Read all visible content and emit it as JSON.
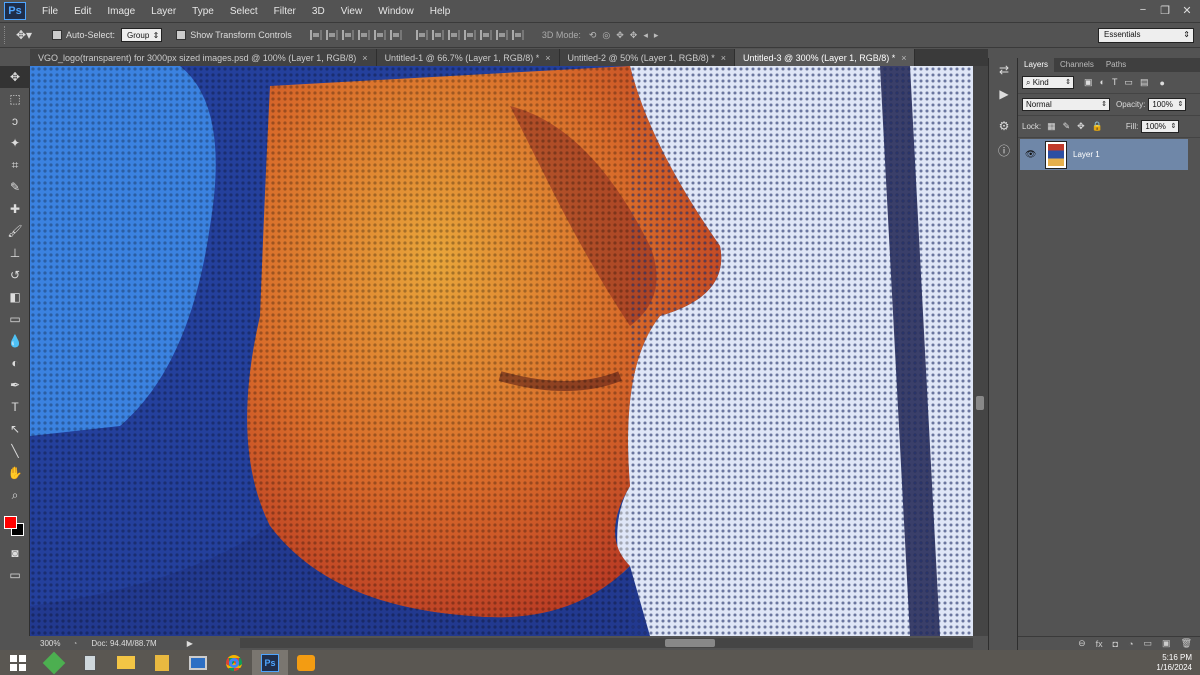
{
  "app": {
    "logo": "Ps"
  },
  "menu": [
    "File",
    "Edit",
    "Image",
    "Layer",
    "Type",
    "Select",
    "Filter",
    "3D",
    "View",
    "Window",
    "Help"
  ],
  "window_buttons": [
    "−",
    "❐",
    "✕"
  ],
  "options": {
    "auto_select_label": "Auto-Select:",
    "auto_select_value": "Group",
    "show_transform_label": "Show Transform Controls",
    "mode_label": "3D Mode:",
    "workspace": "Essentials"
  },
  "doc_tabs": [
    {
      "label": "VGO_logo(transparent) for 3000px sized images.psd @ 100% (Layer 1, RGB/8)",
      "close": "×",
      "active": false
    },
    {
      "label": "Untitled-1 @ 66.7% (Layer 1, RGB/8) *",
      "close": "×",
      "active": false
    },
    {
      "label": "Untitled-2 @ 50% (Layer 1, RGB/8) *",
      "close": "×",
      "active": false
    },
    {
      "label": "Untitled-3 @ 300% (Layer 1, RGB/8) *",
      "close": "×",
      "active": true
    }
  ],
  "tools": [
    "move-icon",
    "marquee-icon",
    "lasso-icon",
    "magic-wand-icon",
    "crop-icon",
    "eyedropper-icon",
    "healing-brush-icon",
    "brush-icon",
    "clone-stamp-icon",
    "history-brush-icon",
    "eraser-icon",
    "gradient-icon",
    "blur-icon",
    "dodge-icon",
    "pen-icon",
    "type-icon",
    "path-selection-icon",
    "line-icon",
    "hand-icon",
    "zoom-icon"
  ],
  "tool_glyphs": [
    "✥",
    "⬚",
    "ↄ",
    "✦",
    "⌗",
    "✎",
    "✚",
    "🖌",
    "⊥",
    "↺",
    "◧",
    "▭",
    "💧",
    "◐",
    "✒",
    "T",
    "↖",
    "╲",
    "✋",
    "⌕"
  ],
  "colors": {
    "foreground": "#ff0000",
    "background": "#000000",
    "selected_layer": "#6f87a8"
  },
  "status": {
    "zoom": "300%",
    "doc": "Doc: 94.4M/88.7M"
  },
  "panel": {
    "tabs": [
      "Layers",
      "Channels",
      "Paths"
    ],
    "kind": "Kind",
    "blend_mode": "Normal",
    "opacity_label": "Opacity:",
    "opacity_value": "100%",
    "lock_label": "Lock:",
    "fill_label": "Fill:",
    "fill_value": "100%",
    "layers": [
      {
        "name": "Layer 1"
      }
    ],
    "footer_icons": [
      "⊖",
      "fx",
      "◘",
      "◔",
      "▭",
      "▣",
      "🗑"
    ]
  },
  "clock": {
    "time": "5:16 PM",
    "date": "1/16/2024"
  }
}
